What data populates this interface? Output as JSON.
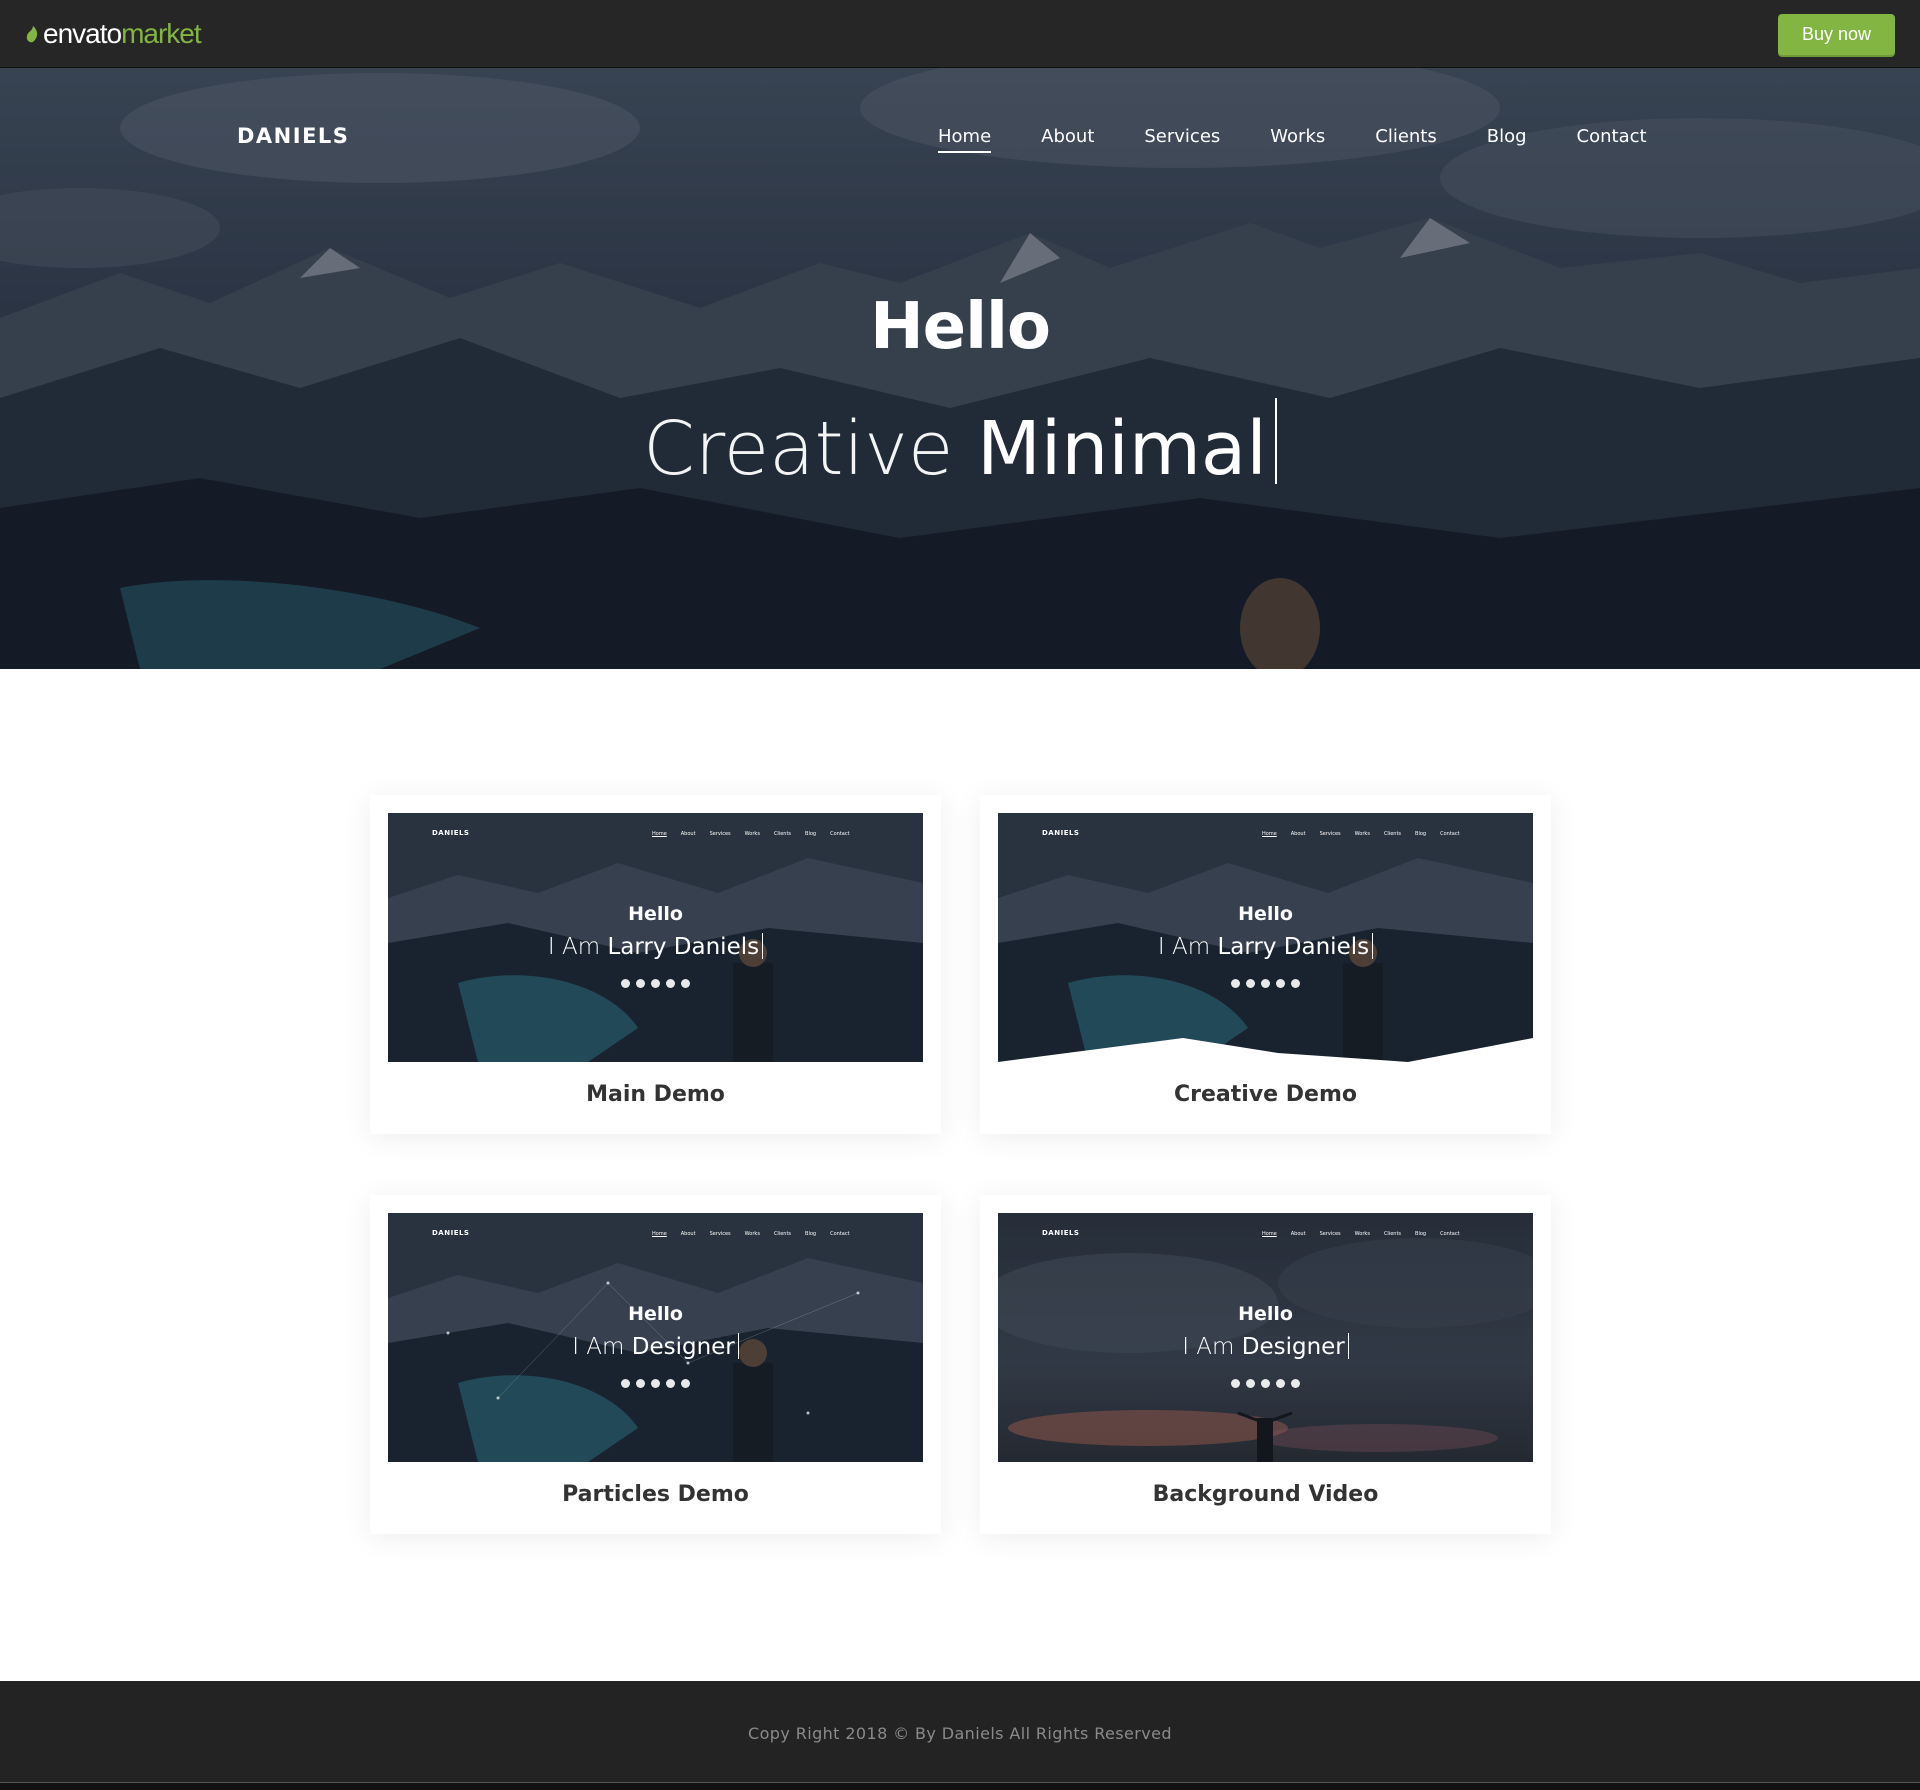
{
  "envato": {
    "logo_left": "envato",
    "logo_right": "market",
    "buy_label": "Buy now"
  },
  "site": {
    "brand": "DANIELS",
    "nav": [
      "Home",
      "About",
      "Services",
      "Works",
      "Clients",
      "Blog",
      "Contact"
    ],
    "active_nav": "Home"
  },
  "hero": {
    "hello": "Hello",
    "prefix": "Creative",
    "highlight": "Minimal"
  },
  "demos": [
    {
      "title": "Main Demo",
      "thumb_prefix": "I Am",
      "thumb_highlight": "Larry Daniels",
      "thumb_hello": "Hello",
      "thumb_brand": "DANIELS"
    },
    {
      "title": "Creative Demo",
      "thumb_prefix": "I Am",
      "thumb_highlight": "Larry Daniels",
      "thumb_hello": "Hello",
      "thumb_brand": "DANIELS"
    },
    {
      "title": "Particles Demo",
      "thumb_prefix": "I Am",
      "thumb_highlight": "Designer",
      "thumb_hello": "Hello",
      "thumb_brand": "DANIELS"
    },
    {
      "title": "Background Video",
      "thumb_prefix": "I Am",
      "thumb_highlight": "Designer",
      "thumb_hello": "Hello",
      "thumb_brand": "DANIELS"
    }
  ],
  "footer": {
    "text": "Copy Right 2018 © By Daniels All Rights Reserved"
  },
  "colors": {
    "envato_green": "#82b541",
    "bar_dark": "#262626",
    "footer_dark": "#232323"
  }
}
